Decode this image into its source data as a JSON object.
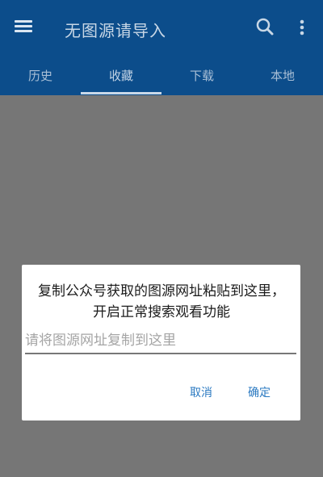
{
  "appbar": {
    "title": "无图源请导入",
    "menu_icon": "menu-icon",
    "search_icon": "search-icon",
    "more_icon": "more-vert-icon",
    "color": "#0c4d8b"
  },
  "tabs": [
    {
      "label": "历史"
    },
    {
      "label": "收藏"
    },
    {
      "label": "下载"
    },
    {
      "label": "本地"
    }
  ],
  "active_tab": "收藏",
  "dialog": {
    "message": "复制公众号获取的图源网址粘贴到这里，开启正常搜索观看功能",
    "input_placeholder": "请将图源网址复制到这里",
    "input_value": "",
    "cancel_label": "取消",
    "confirm_label": "确定",
    "button_color": "#2a79c1"
  }
}
